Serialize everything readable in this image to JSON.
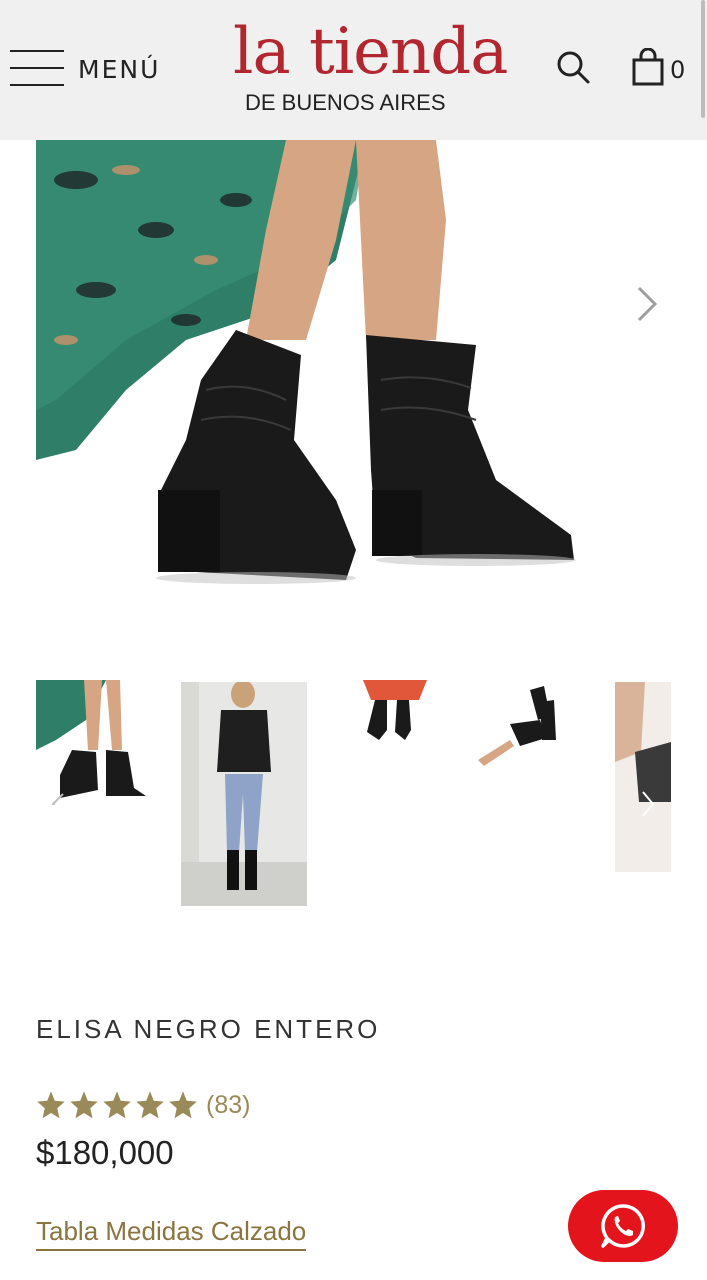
{
  "header": {
    "menu_label": "MENÚ",
    "logo_top": "la tienda",
    "logo_bottom": "DE BUENOS AIRES",
    "cart_count": "0"
  },
  "product": {
    "title": "ELISA NEGRO ENTERO",
    "rating_stars": 5,
    "rating_count": "(83)",
    "price": "$180,000",
    "size_chart_link": "Tabla Medidas Calzado"
  },
  "colors": {
    "brand_red": "#b2262f",
    "star_gold": "#9a8a5a",
    "link_gold": "#8a7540",
    "whatsapp_red": "#e3141b"
  },
  "icons": [
    "hamburger-icon",
    "search-icon",
    "shopping-bag-icon",
    "chevron-right-icon",
    "chevron-left-icon",
    "star-icon",
    "whatsapp-icon"
  ]
}
